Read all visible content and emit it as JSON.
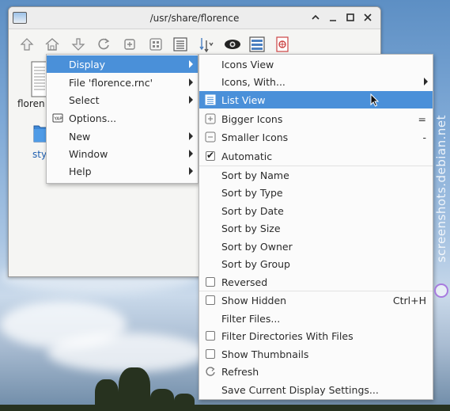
{
  "window": {
    "title": "/usr/share/florence",
    "controls": {
      "maximize_up": "^",
      "minimize": "_",
      "restore": "□",
      "close": "✕"
    }
  },
  "toolbar": {
    "icons": [
      "up-arrow-icon",
      "home-icon",
      "navigate-icon",
      "reload-icon",
      "new-folder-icon",
      "icons-view-icon",
      "list-view-icon",
      "sort-icon",
      "show-hidden-eye-icon",
      "details-view-icon",
      "filter-icon"
    ]
  },
  "files": [
    {
      "label": "floren",
      "icon": "text-file-icon"
    },
    {
      "label": "sty",
      "icon": "folder-icon"
    }
  ],
  "main_menu": {
    "items": [
      {
        "label": "Display",
        "submenu": true,
        "highlighted": true
      },
      {
        "label": "File 'florence.rnc'",
        "submenu": true
      },
      {
        "label": "Select",
        "submenu": true
      },
      {
        "label": "Options...",
        "submenu": false,
        "icon": "preferences-icon"
      },
      {
        "label": "New",
        "submenu": true
      },
      {
        "label": "Window",
        "submenu": true
      },
      {
        "label": "Help",
        "submenu": true
      }
    ]
  },
  "display_menu": {
    "items": [
      {
        "label": "Icons View"
      },
      {
        "label": "Icons, With...",
        "submenu": true
      },
      {
        "label": "List View",
        "highlighted": true,
        "checkbox": false
      },
      {
        "label": "Bigger Icons",
        "accel": "=",
        "icon": "zoom-in-icon"
      },
      {
        "label": "Smaller Icons",
        "accel": "-",
        "icon": "zoom-out-icon"
      },
      {
        "label": "Automatic",
        "checked": true
      },
      {
        "label": "Sort by Name"
      },
      {
        "label": "Sort by Type"
      },
      {
        "label": "Sort by Date"
      },
      {
        "label": "Sort by Size"
      },
      {
        "label": "Sort by Owner"
      },
      {
        "label": "Sort by Group"
      },
      {
        "label": "Reversed",
        "checked": false
      },
      {
        "label": "Show Hidden",
        "checked": false,
        "accel": "Ctrl+H"
      },
      {
        "label": "Filter Files..."
      },
      {
        "label": "Filter Directories With Files",
        "checked": false
      },
      {
        "label": "Show Thumbnails",
        "checked": false
      },
      {
        "label": "Refresh",
        "icon": "refresh-icon"
      },
      {
        "label": "Save Current Display Settings..."
      }
    ]
  },
  "watermark": "screenshots.debian.net",
  "colors": {
    "highlight": "#4a90d9",
    "menu_bg": "#fbfbfb"
  }
}
